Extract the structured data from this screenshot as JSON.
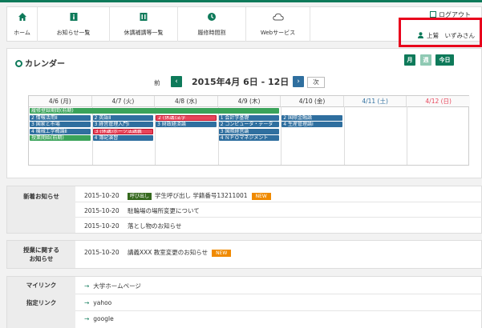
{
  "colors": {
    "brand": "#0e7a5a",
    "highlight": "#e8001c",
    "badge_new": "#f08a00",
    "badge_call": "#35691e",
    "ev_blue": "#2f6f9f",
    "ev_green": "#3aa35a",
    "ev_red": "#e8455a"
  },
  "nav": {
    "items": [
      {
        "label": "ホーム",
        "icon": "home-icon"
      },
      {
        "label": "お知らせ一覧",
        "icon": "info-icon"
      },
      {
        "label": "休講補講等一覧",
        "icon": "grid-icon"
      },
      {
        "label": "履修時間割",
        "icon": "clock-icon"
      },
      {
        "label": "Webサービス",
        "icon": "cloud-icon"
      }
    ],
    "logout": "ログアウト",
    "user": "上鷲　いずみさん"
  },
  "calendar": {
    "title": "カレンダー",
    "views": [
      "月",
      "週",
      "今日"
    ],
    "prev": "前",
    "next": "次",
    "range": "2015年4月 6日 - 12日",
    "days": [
      "4/6 (月)",
      "4/7 (火)",
      "4/8 (水)",
      "4/9 (木)",
      "4/10 (金)",
      "4/11 (土)",
      "4/12 (日)"
    ],
    "events": [
      {
        "day": 0,
        "row": 0,
        "span": 4,
        "label": "履修登録期間(前期)",
        "color": "green"
      },
      {
        "day": 0,
        "row": 1,
        "label": "2 情報活用Ⅱ",
        "color": "blue"
      },
      {
        "day": 0,
        "row": 2,
        "label": "3 国家と市場",
        "color": "blue"
      },
      {
        "day": 0,
        "row": 3,
        "label": "4 機械工学概論Ⅱ",
        "color": "blue"
      },
      {
        "day": 0,
        "row": 4,
        "label": "授業開始(前期)",
        "color": "green"
      },
      {
        "day": 1,
        "row": 1,
        "label": "2 英語Ⅱ",
        "color": "blue"
      },
      {
        "day": 1,
        "row": 2,
        "label": "3 経営管理入門Ⅰ",
        "color": "blue"
      },
      {
        "day": 1,
        "row": 3,
        "label": "3 (休講)ポーツ法講義",
        "color": "red"
      },
      {
        "day": 1,
        "row": 4,
        "label": "4 簿記演習",
        "color": "blue"
      },
      {
        "day": 2,
        "row": 1,
        "label": "2 (休講)法学",
        "color": "red"
      },
      {
        "day": 2,
        "row": 2,
        "label": "3 財政経済論",
        "color": "blue"
      },
      {
        "day": 3,
        "row": 1,
        "label": "1 会計学基礎",
        "color": "blue"
      },
      {
        "day": 3,
        "row": 2,
        "label": "2 コンピュータ・データ",
        "color": "blue"
      },
      {
        "day": 3,
        "row": 3,
        "label": "3 国際経営論",
        "color": "blue"
      },
      {
        "day": 3,
        "row": 4,
        "label": "4 ＮＰＯマネジメント",
        "color": "blue"
      },
      {
        "day": 4,
        "row": 1,
        "label": "2 国際金融論",
        "color": "blue"
      },
      {
        "day": 4,
        "row": 2,
        "label": "4 生産管理論Ⅰ",
        "color": "blue"
      }
    ]
  },
  "news": {
    "label": "新着お知らせ",
    "items": [
      {
        "date": "2015-10-20",
        "tag": "呼び出し",
        "text": "学生呼び出し 学籍番号13211001",
        "new": "NEW"
      },
      {
        "date": "2015-10-20",
        "tag": "",
        "text": "駐輪場の場所変更について",
        "new": ""
      },
      {
        "date": "2015-10-20",
        "tag": "",
        "text": "落とし物のお知らせ",
        "new": ""
      }
    ]
  },
  "class_news": {
    "label_1": "授業に関する",
    "label_2": "お知らせ",
    "date": "2015-10-20",
    "text": "講義XXX 教室変更のお知らせ",
    "new": "NEW"
  },
  "mylinks": {
    "label": "マイリンク",
    "items": [
      "大学ホームページ"
    ]
  },
  "speclinks": {
    "label": "指定リンク",
    "items": [
      "yahoo",
      "google"
    ]
  }
}
